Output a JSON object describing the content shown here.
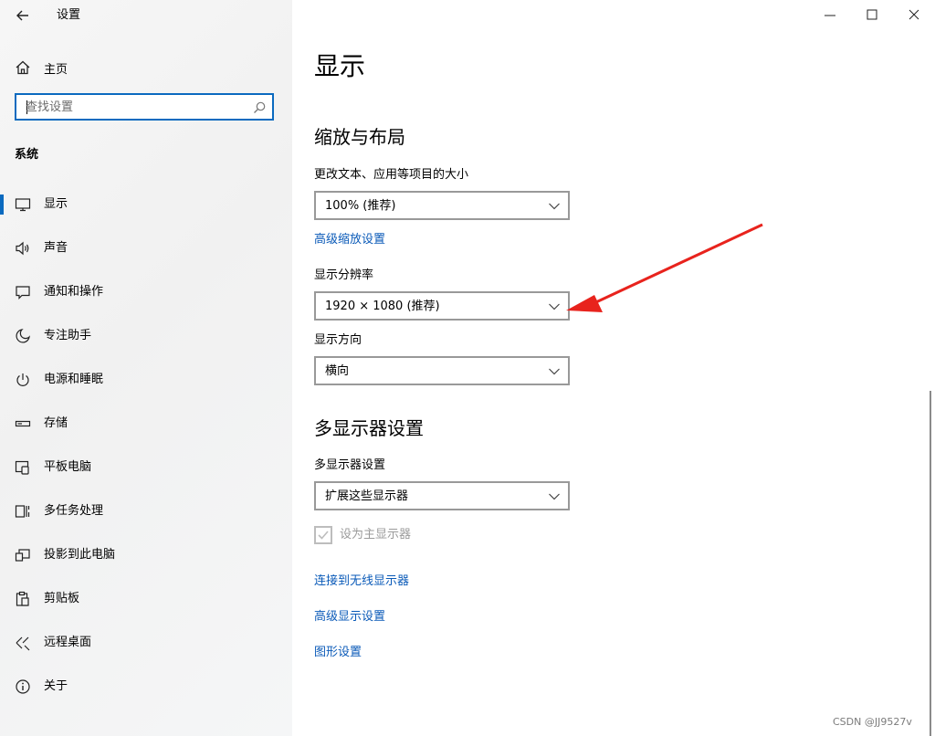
{
  "app": {
    "title": "设置"
  },
  "sidebar": {
    "home_label": "主页",
    "search_placeholder": "查找设置",
    "section": "系统",
    "items": [
      {
        "label": "显示",
        "icon": "monitor-icon",
        "active": true
      },
      {
        "label": "声音",
        "icon": "speaker-icon"
      },
      {
        "label": "通知和操作",
        "icon": "notification-icon"
      },
      {
        "label": "专注助手",
        "icon": "moon-icon"
      },
      {
        "label": "电源和睡眠",
        "icon": "power-icon"
      },
      {
        "label": "存储",
        "icon": "storage-icon"
      },
      {
        "label": "平板电脑",
        "icon": "tablet-icon"
      },
      {
        "label": "多任务处理",
        "icon": "multitask-icon"
      },
      {
        "label": "投影到此电脑",
        "icon": "project-icon"
      },
      {
        "label": "剪贴板",
        "icon": "clipboard-icon"
      },
      {
        "label": "远程桌面",
        "icon": "remote-desktop-icon"
      },
      {
        "label": "关于",
        "icon": "info-icon"
      }
    ]
  },
  "main": {
    "title": "显示",
    "scale_section": {
      "heading": "缩放与布局",
      "scale_label": "更改文本、应用等项目的大小",
      "scale_value": "100% (推荐)",
      "advanced_scaling_link": "高级缩放设置",
      "resolution_label": "显示分辨率",
      "resolution_value": "1920 × 1080 (推荐)",
      "orientation_label": "显示方向",
      "orientation_value": "横向"
    },
    "multi_section": {
      "heading": "多显示器设置",
      "multi_label": "多显示器设置",
      "multi_value": "扩展这些显示器",
      "main_display_checkbox": "设为主显示器"
    },
    "links": {
      "wireless": "连接到无线显示器",
      "advanced_display": "高级显示设置",
      "graphics": "图形设置"
    }
  },
  "watermark": "CSDN @JJ9527v",
  "colors": {
    "accent": "#0b6abf",
    "link": "#0a5ab8",
    "annotation_arrow": "#e8231d"
  }
}
